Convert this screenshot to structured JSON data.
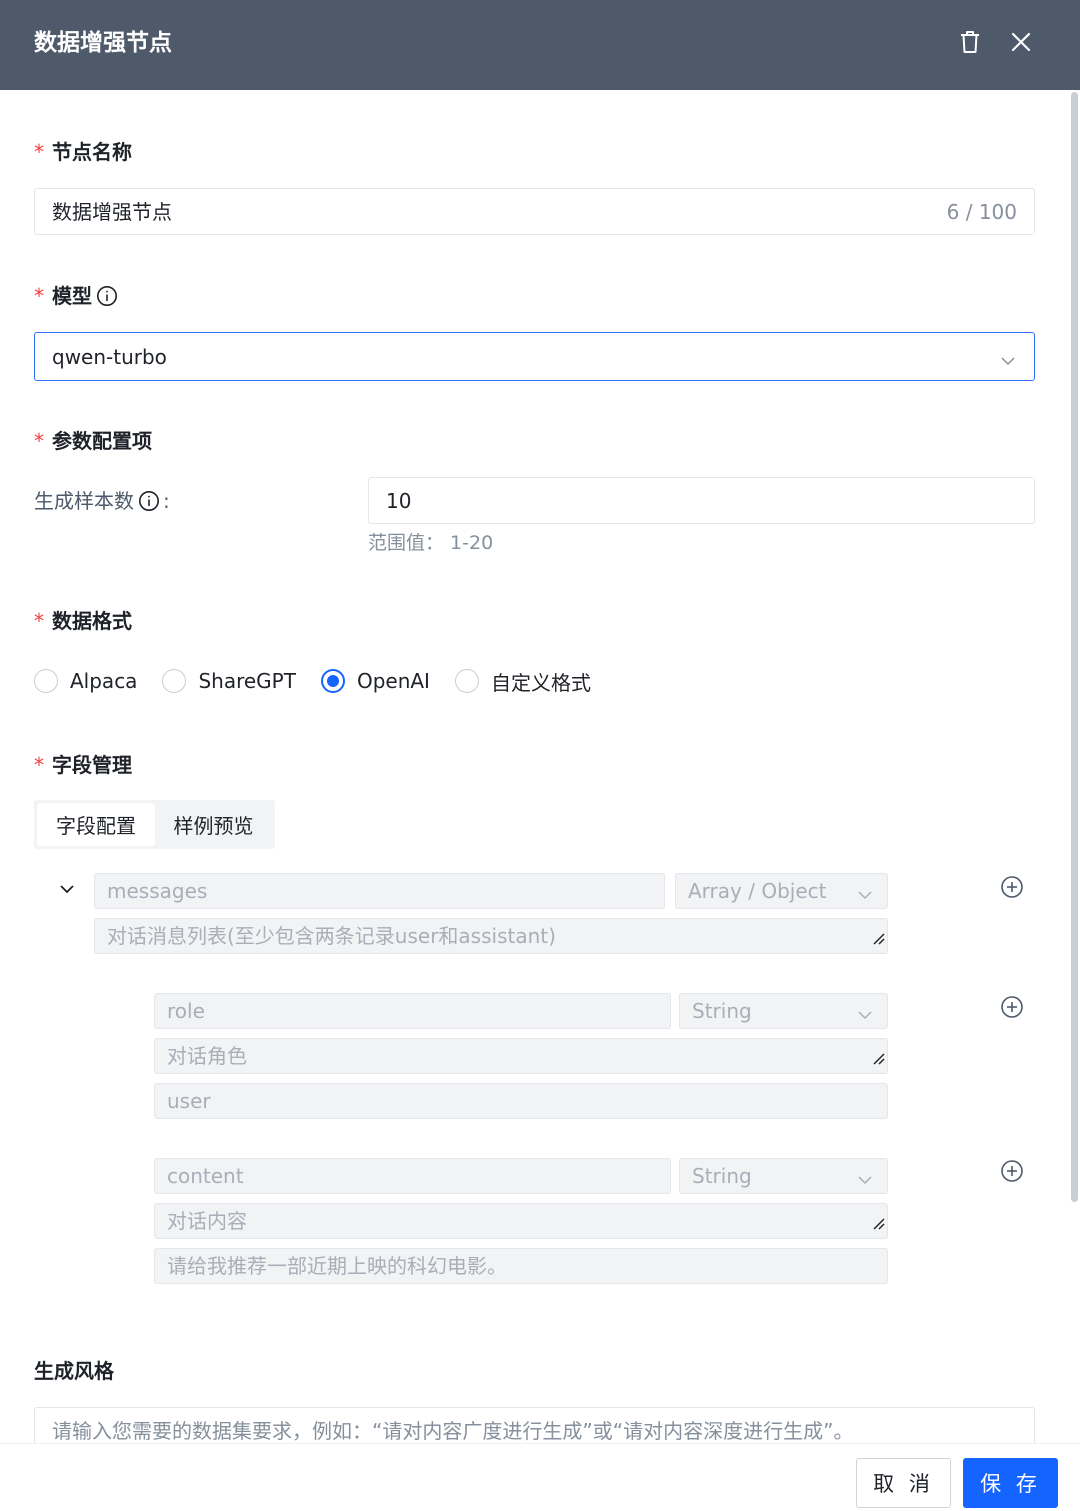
{
  "header": {
    "title": "数据增强节点",
    "delete_icon": "trash-icon",
    "close_icon": "close-icon"
  },
  "node_name": {
    "label": "节点名称",
    "value": "数据增强节点",
    "count": "6 / 100"
  },
  "model": {
    "label": "模型",
    "value": "qwen-turbo"
  },
  "params": {
    "label": "参数配置项",
    "sample_count_label": "生成样本数",
    "sample_count_value": "10",
    "range_hint": "范围值： 1-20"
  },
  "data_format": {
    "label": "数据格式",
    "options": [
      {
        "label": "Alpaca",
        "checked": false
      },
      {
        "label": "ShareGPT",
        "checked": false
      },
      {
        "label": "OpenAI",
        "checked": true
      },
      {
        "label": "自定义格式",
        "checked": false
      }
    ]
  },
  "fields": {
    "label": "字段管理",
    "tabs": [
      "字段配置",
      "样例预览"
    ],
    "messages": {
      "name": "messages",
      "type": "Array / Object",
      "description": "对话消息列表(至少包含两条记录user和assistant)"
    },
    "role": {
      "name": "role",
      "type": "String",
      "description": "对话角色",
      "example": "user"
    },
    "content": {
      "name": "content",
      "type": "String",
      "description": "对话内容",
      "example": "请给我推荐一部近期上映的科幻电影。"
    }
  },
  "style": {
    "label": "生成风格",
    "placeholder": "请输入您需要的数据集要求，例如：“请对内容广度进行生成”或“请对内容深度进行生成”。"
  },
  "footer": {
    "cancel": "取 消",
    "save": "保 存"
  },
  "colors": {
    "header_bg": "#4e5969",
    "primary": "#1664ff",
    "required": "#f53f3f"
  }
}
